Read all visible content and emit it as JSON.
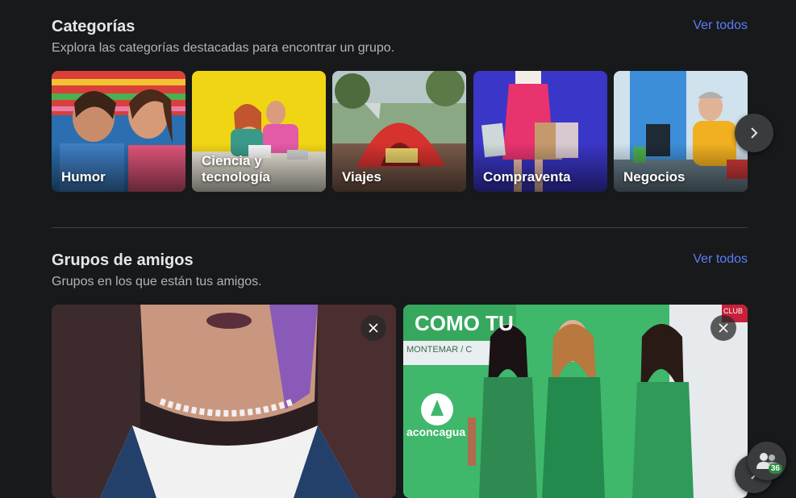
{
  "categories": {
    "title": "Categorías",
    "subtitle": "Explora las categorías destacadas para encontrar un grupo.",
    "see_all": "Ver todos",
    "items": [
      {
        "label": "Humor"
      },
      {
        "label": "Ciencia y tecnología"
      },
      {
        "label": "Viajes"
      },
      {
        "label": "Compraventa"
      },
      {
        "label": "Negocios"
      }
    ]
  },
  "friends_groups": {
    "title": "Grupos de amigos",
    "subtitle": "Grupos en los que están tus amigos.",
    "see_all": "Ver todos",
    "photo_text": {
      "banner": "COMO TU",
      "sign": "MONTEMAR / C",
      "brand": "aconcagua",
      "corner_badge": "CLUB"
    }
  },
  "friends_fab": {
    "count": "36"
  },
  "colors": {
    "background": "#18191a",
    "link": "#5c7cfa",
    "button": "#3a3b3c"
  }
}
